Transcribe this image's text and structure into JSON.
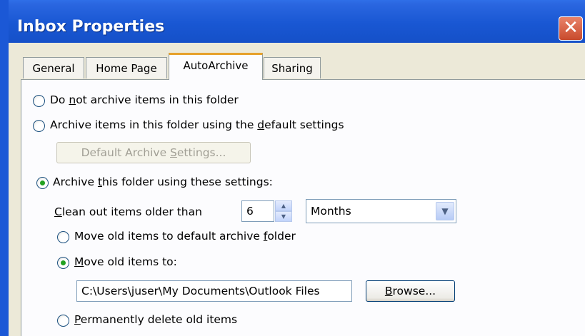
{
  "window": {
    "title": "Inbox Properties",
    "close_glyph": "✕"
  },
  "tabs": [
    {
      "label": "General",
      "active": false
    },
    {
      "label": "Home Page",
      "active": false
    },
    {
      "label": "AutoArchive",
      "active": true
    },
    {
      "label": "Sharing",
      "active": false
    }
  ],
  "options": {
    "do_not_archive": {
      "pre": "Do ",
      "accel": "n",
      "post": "ot archive items in this folder",
      "checked": false
    },
    "archive_default": {
      "pre": "Archive items in this folder using the ",
      "accel": "d",
      "post": "efault settings",
      "checked": false
    },
    "default_settings_button": {
      "pre": "Default Archive ",
      "accel": "S",
      "post": "ettings...",
      "enabled": false
    },
    "archive_custom": {
      "pre": "Archive ",
      "accel": "t",
      "post": "his folder using these settings:",
      "checked": true
    }
  },
  "clean_out": {
    "label_accel": "C",
    "label_rest": "lean out items older than",
    "value": "6",
    "unit": "Months"
  },
  "move_options": {
    "default_folder": {
      "pre": "Move old items to default archive ",
      "accel": "f",
      "post": "older",
      "checked": false
    },
    "move_to": {
      "accel": "M",
      "post": "ove old items to:",
      "checked": true
    },
    "path": "C:\\Users\\juser\\My Documents\\Outlook Files",
    "browse": {
      "accel": "B",
      "post": "rowse..."
    },
    "delete": {
      "accel": "P",
      "post": "ermanently delete old items",
      "checked": false
    }
  },
  "colors": {
    "titlebar": "#1957d3",
    "panel": "#fcfcfe",
    "active_tab_accent": "#e6a12b",
    "radio_dot": "#21a121"
  }
}
